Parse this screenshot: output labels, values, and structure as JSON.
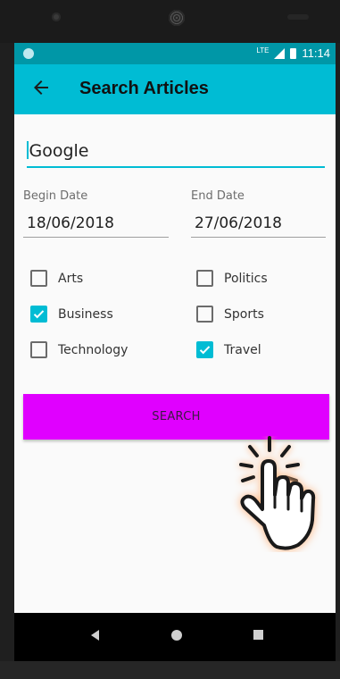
{
  "status_bar": {
    "network": "LTE",
    "time": "11:14"
  },
  "app_bar": {
    "title": "Search Articles",
    "back_icon": "arrow-back-icon"
  },
  "search": {
    "query": "Google"
  },
  "dates": {
    "begin_label": "Begin Date",
    "begin_value": "18/06/2018",
    "end_label": "End Date",
    "end_value": "27/06/2018"
  },
  "categories": [
    {
      "label": "Arts",
      "checked": false
    },
    {
      "label": "Politics",
      "checked": false
    },
    {
      "label": "Business",
      "checked": true
    },
    {
      "label": "Sports",
      "checked": false
    },
    {
      "label": "Technology",
      "checked": false
    },
    {
      "label": "Travel",
      "checked": true
    }
  ],
  "search_button": {
    "label": "SEARCH"
  },
  "colors": {
    "status_bar": "#0097a7",
    "app_bar": "#00bcd4",
    "accent": "#00bcd4",
    "button": "#e000ff"
  },
  "overlay": {
    "icon": "tap-hand-icon"
  },
  "nav": {
    "back": "nav-back-icon",
    "home": "nav-home-icon",
    "recent": "nav-recent-icon"
  }
}
